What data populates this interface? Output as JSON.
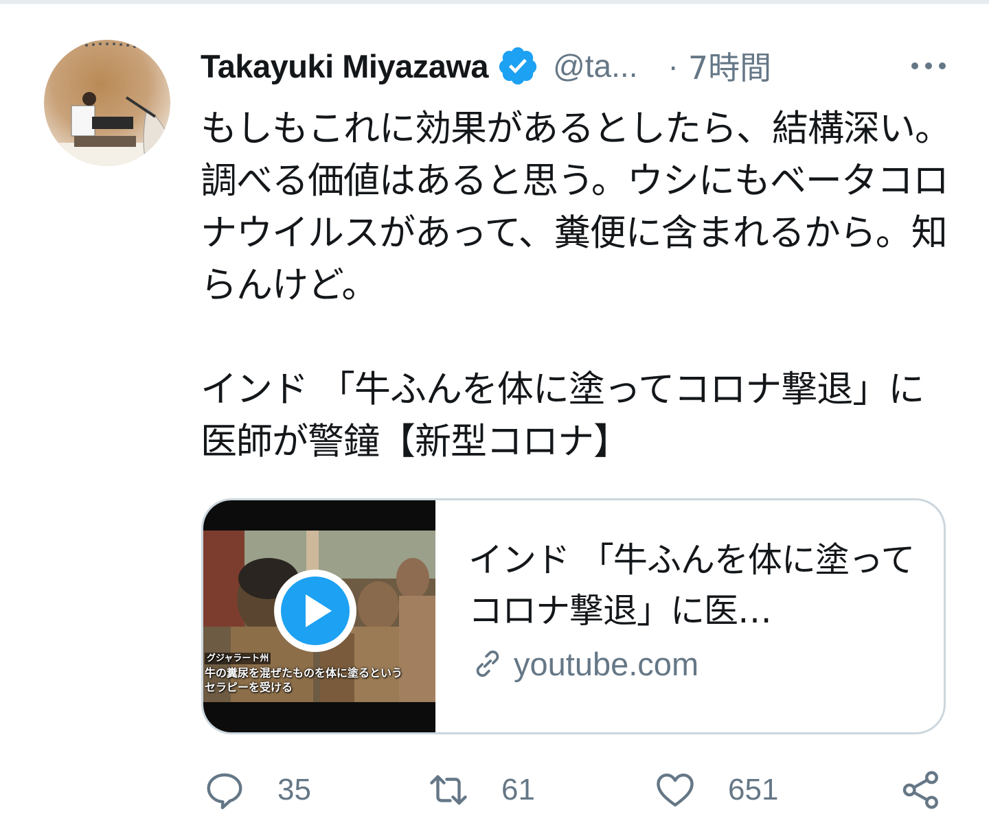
{
  "tweet": {
    "author": {
      "name": "Takayuki Miyazawa",
      "handle": "@ta...",
      "verified": true
    },
    "separator": "·",
    "time": "7時間",
    "more_icon": "more-horizontal-icon",
    "text": "もしもこれに効果があるとしたら、結構深い。調べる価値はあると思う。ウシにもベータコロナウイルスがあって、糞便に含まれるから。知らんけど。\n\nインド 「牛ふんを体に塗ってコロナ撃退」に医師が警鐘【新型コロナ】",
    "card": {
      "thumbnail_region": "グジャラート州",
      "thumbnail_caption_1": "牛の糞尿を混ぜたものを体に塗るという",
      "thumbnail_caption_2": "セラピーを受ける",
      "title": "インド 「牛ふんを体に塗ってコロナ撃退」に医…",
      "domain": "youtube.com",
      "play_icon": "play-icon",
      "link_icon": "link-icon"
    },
    "actions": {
      "reply_count": "35",
      "retweet_count": "61",
      "like_count": "651",
      "share_icon": "share-icon"
    }
  },
  "colors": {
    "text": "#14171a",
    "secondary": "#657786",
    "accent": "#1da1f2",
    "border": "#ccd6dd"
  }
}
